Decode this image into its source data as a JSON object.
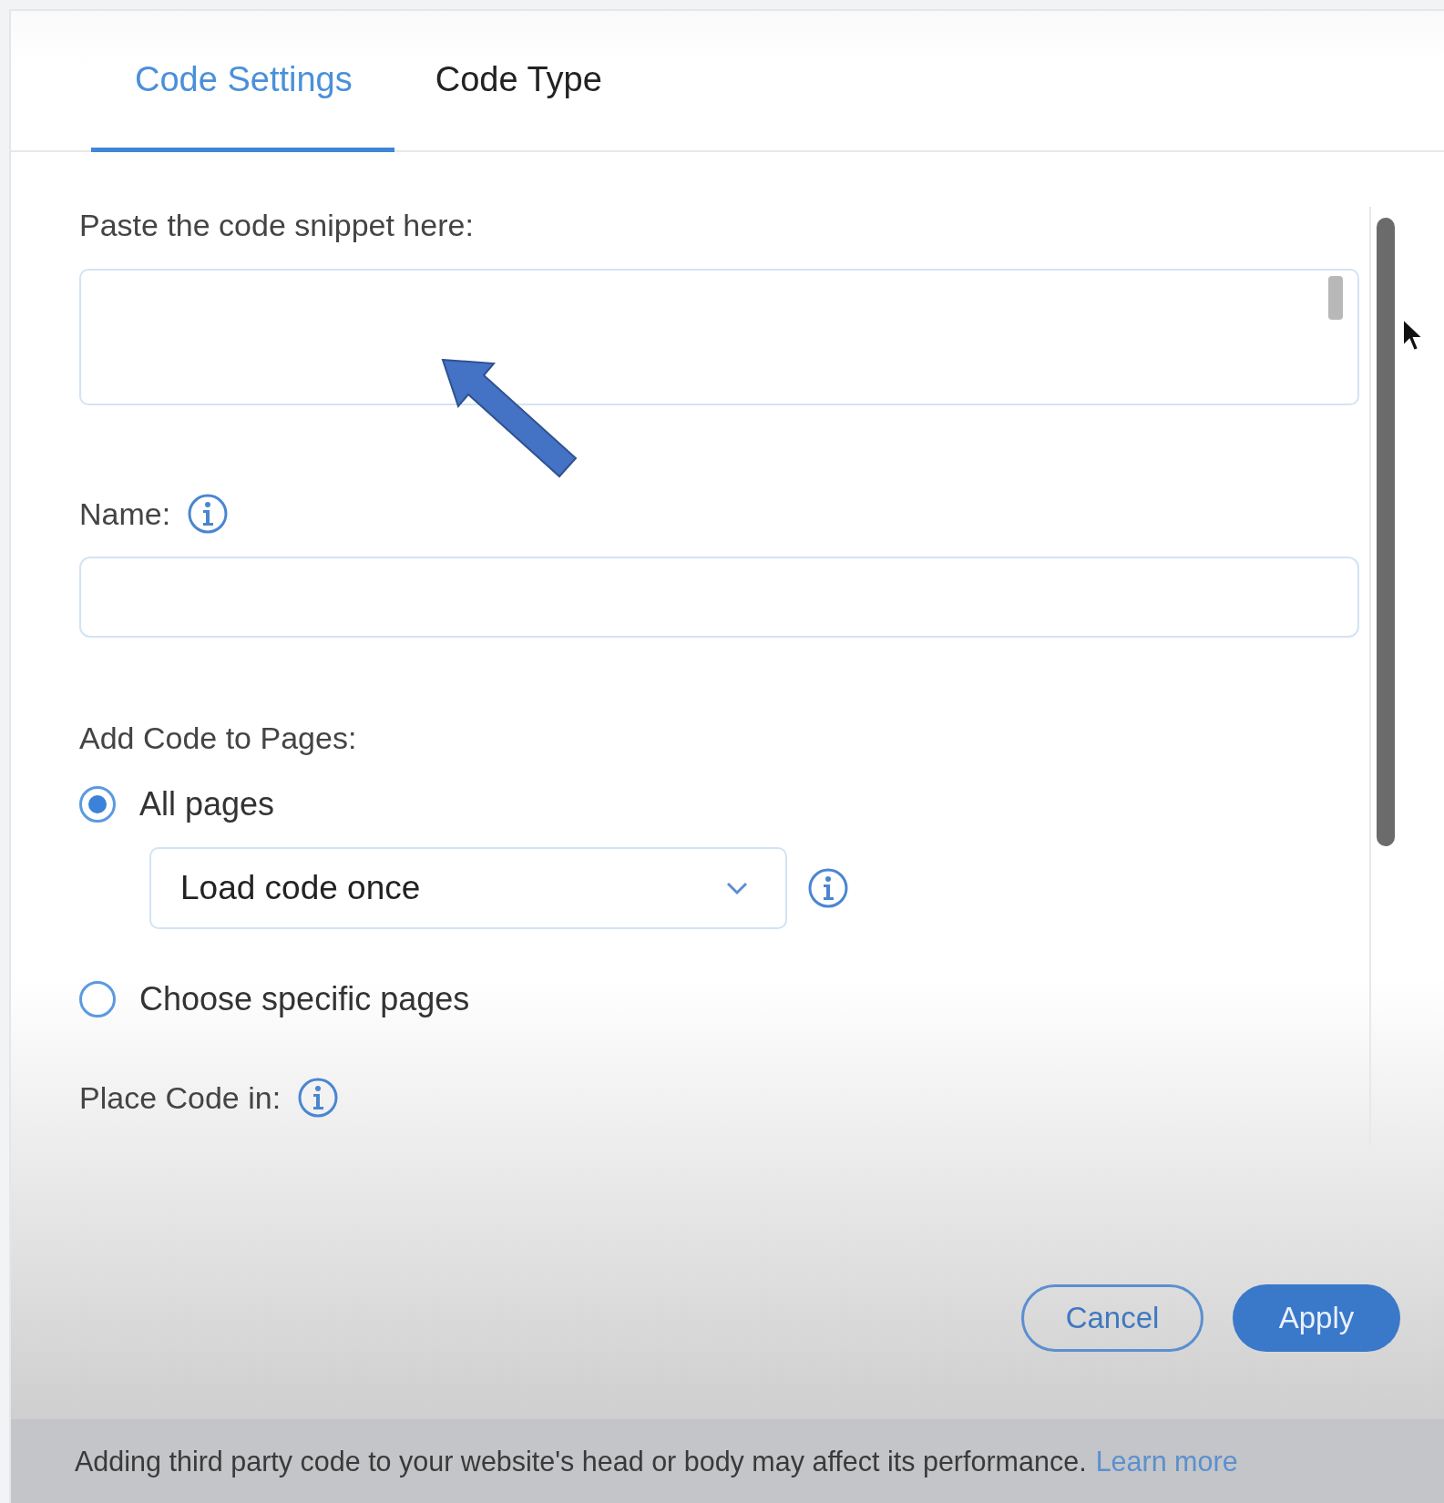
{
  "tabs": [
    {
      "label": "Code Settings",
      "selected": true
    },
    {
      "label": "Code Type",
      "selected": false
    }
  ],
  "snippet": {
    "label": "Paste the code snippet here:"
  },
  "name": {
    "label": "Name:"
  },
  "pages": {
    "label": "Add Code to Pages:",
    "options": [
      {
        "label": "All pages",
        "selected": true
      },
      {
        "label": "Choose specific pages",
        "selected": false
      }
    ],
    "load": {
      "value": "Load code once"
    }
  },
  "placement": {
    "label": "Place Code in:"
  },
  "buttons": [
    {
      "label": "Cancel",
      "kind": "secondary"
    },
    {
      "label": "Apply",
      "kind": "primary"
    }
  ],
  "footer": {
    "text": "Adding third party code to your website's head or body may affect its performance.",
    "link": "Learn more"
  }
}
